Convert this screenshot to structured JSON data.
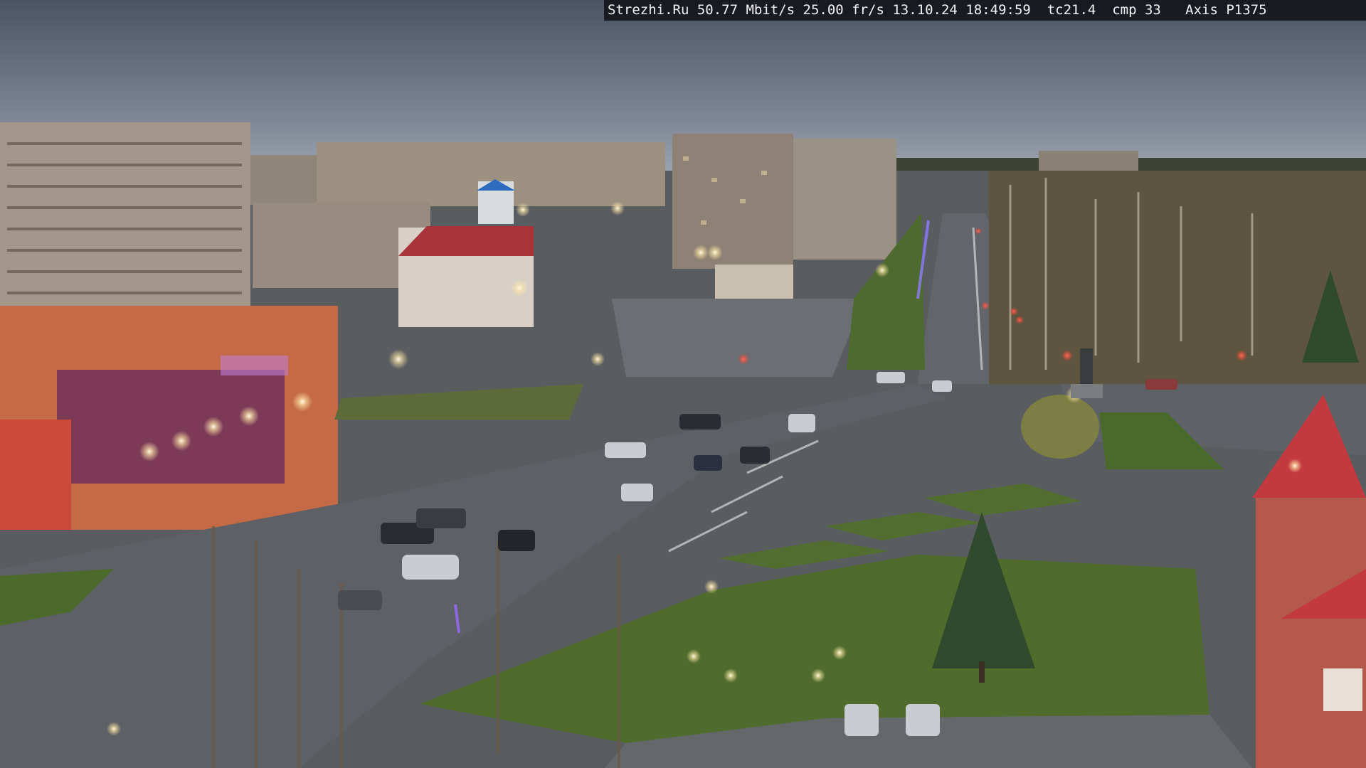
{
  "camera_overlay": {
    "text": "Strezhi.Ru 50.77 Mbit/s 25.00 fr/s 13.10.24 18:49:59  tc21.4  cmp 33   Axis P1375"
  },
  "scene": {
    "description_icon": "city-webcam-view",
    "colors": {
      "sky_top": "#4d5566",
      "sky_bottom": "#9098a6",
      "road": "#5c5f63",
      "grass": "#4f6e2c",
      "building_panel": "#a89a8c",
      "shopping_center": "#c9653f",
      "shop_sign": "#7a2a56",
      "street_light": "#fff6d0",
      "red_roof": "#b23a3e"
    }
  }
}
